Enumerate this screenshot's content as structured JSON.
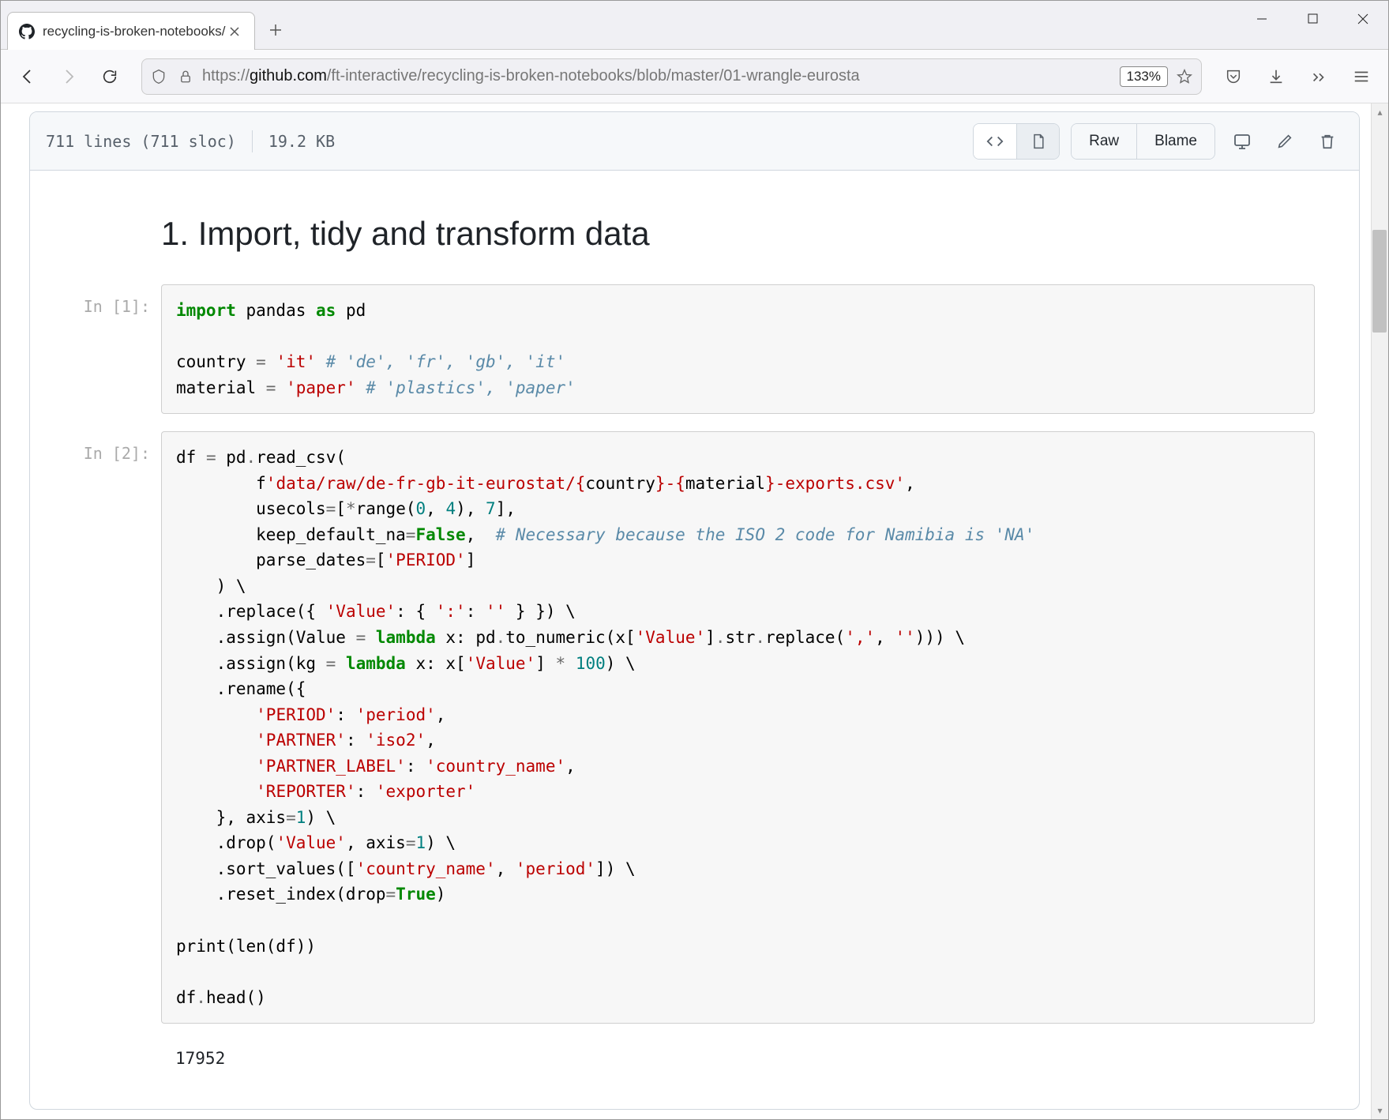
{
  "browser": {
    "tab_title": "recycling-is-broken-notebooks/",
    "url_prefix": "https://",
    "url_host": "github.com",
    "url_path": "/ft-interactive/recycling-is-broken-notebooks/blob/master/01-wrangle-eurosta",
    "zoom": "133%"
  },
  "file_header": {
    "lines": "711 lines (711 sloc)",
    "size": "19.2 KB",
    "raw": "Raw",
    "blame": "Blame"
  },
  "notebook": {
    "heading": "1. Import, tidy and transform data",
    "prompt1": "In [1]:",
    "prompt2": "In [2]:",
    "output1": "17952"
  },
  "code1": {
    "l1_import": "import",
    "l1_pandas": " pandas ",
    "l1_as": "as",
    "l1_pd": " pd",
    "l3a": "country ",
    "l3b": "=",
    "l3c": " 'it'",
    "l3d": " # 'de', 'fr', 'gb', 'it'",
    "l4a": "material ",
    "l4b": "=",
    "l4c": " 'paper'",
    "l4d": " # 'plastics', 'paper'"
  },
  "code2": {
    "l01": "df ",
    "l01b": "=",
    "l01c": " pd",
    "l01d": ".",
    "l01e": "read_csv(",
    "l02a": "        f",
    "l02b": "'data/raw/de-fr-gb-it-eurostat/",
    "l02c": "{",
    "l02d": "country",
    "l02e": "}",
    "l02f": "-",
    "l02g": "{",
    "l02h": "material",
    "l02i": "}",
    "l02j": "-exports.csv'",
    "l02k": ",",
    "l03a": "        usecols",
    "l03b": "=",
    "l03c": "[",
    "l03d": "*",
    "l03e": "range(",
    "l03f": "0",
    "l03g": ", ",
    "l03h": "4",
    "l03i": "), ",
    "l03j": "7",
    "l03k": "],",
    "l04a": "        keep_default_na",
    "l04b": "=",
    "l04c": "False",
    "l04d": ",  ",
    "l04e": "# Necessary because the ISO 2 code for Namibia is 'NA'",
    "l05a": "        parse_dates",
    "l05b": "=",
    "l05c": "[",
    "l05d": "'PERIOD'",
    "l05e": "]",
    "l06": "    ) \\",
    "l07a": "    .replace({ ",
    "l07b": "'Value'",
    "l07c": ": { ",
    "l07d": "':'",
    "l07e": ": ",
    "l07f": "''",
    "l07g": " } }) \\",
    "l08a": "    .assign(Value ",
    "l08b": "=",
    "l08c": " ",
    "l08d": "lambda",
    "l08e": " x: pd",
    "l08f": ".",
    "l08g": "to_numeric(x[",
    "l08h": "'Value'",
    "l08i": "]",
    "l08j": ".",
    "l08k": "str",
    "l08l": ".",
    "l08m": "replace(",
    "l08n": "','",
    "l08o": ", ",
    "l08p": "''",
    "l08q": "))) \\",
    "l09a": "    .assign(kg ",
    "l09b": "=",
    "l09c": " ",
    "l09d": "lambda",
    "l09e": " x: x[",
    "l09f": "'Value'",
    "l09g": "] ",
    "l09h": "*",
    "l09i": " ",
    "l09j": "100",
    "l09k": ") \\",
    "l10": "    .rename({",
    "l11a": "        ",
    "l11b": "'PERIOD'",
    "l11c": ": ",
    "l11d": "'period'",
    "l11e": ",",
    "l12a": "        ",
    "l12b": "'PARTNER'",
    "l12c": ": ",
    "l12d": "'iso2'",
    "l12e": ",",
    "l13a": "        ",
    "l13b": "'PARTNER_LABEL'",
    "l13c": ": ",
    "l13d": "'country_name'",
    "l13e": ",",
    "l14a": "        ",
    "l14b": "'REPORTER'",
    "l14c": ": ",
    "l14d": "'exporter'",
    "l15a": "    }, axis",
    "l15b": "=",
    "l15c": "1",
    "l15d": ") \\",
    "l16a": "    .drop(",
    "l16b": "'Value'",
    "l16c": ", axis",
    "l16d": "=",
    "l16e": "1",
    "l16f": ") \\",
    "l17a": "    .sort_values([",
    "l17b": "'country_name'",
    "l17c": ", ",
    "l17d": "'period'",
    "l17e": "]) \\",
    "l18a": "    .reset_index(drop",
    "l18b": "=",
    "l18c": "True",
    "l18d": ")",
    "l20": "print(len(df))",
    "l22": "df",
    "l22b": ".",
    "l22c": "head()"
  }
}
